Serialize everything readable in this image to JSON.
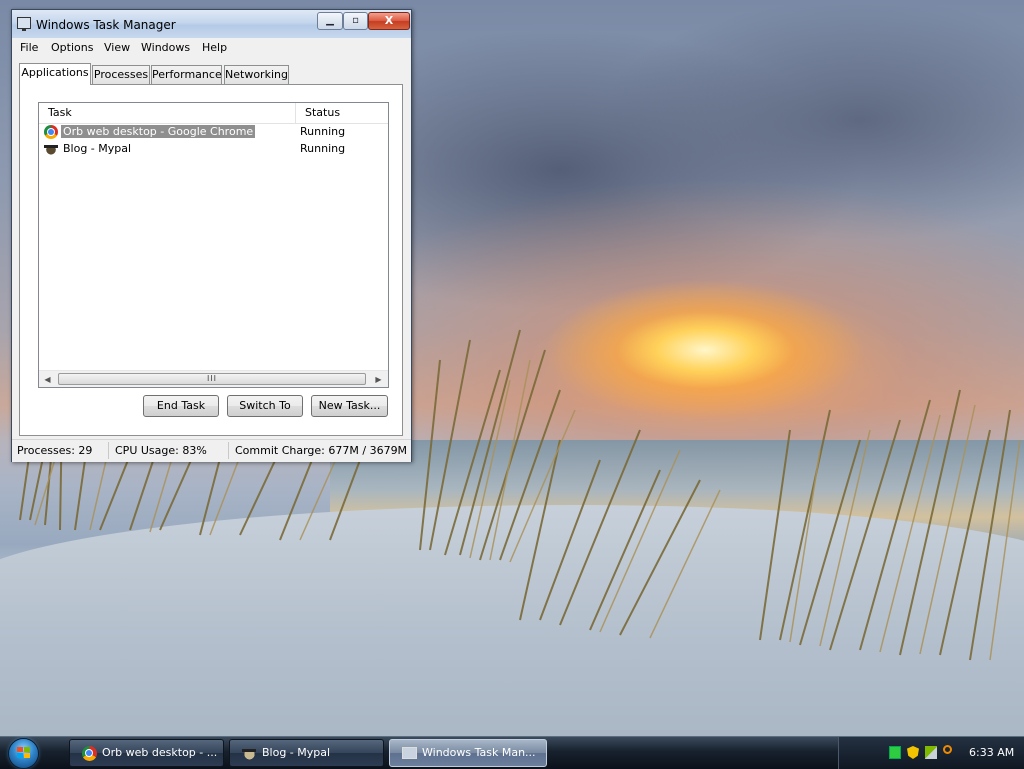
{
  "window": {
    "title": "Windows Task Manager",
    "caption_buttons": {
      "minimize": "▁",
      "maximize": "▫",
      "close": "X"
    }
  },
  "menu": [
    "File",
    "Options",
    "View",
    "Windows",
    "Help"
  ],
  "tabs": [
    "Applications",
    "Processes",
    "Performance",
    "Networking"
  ],
  "active_tab": "Applications",
  "list": {
    "columns": {
      "task": "Task",
      "status": "Status"
    },
    "rows": [
      {
        "task": "Orb web desktop - Google Chrome",
        "status": "Running",
        "icon": "chrome-icon",
        "selected": true
      },
      {
        "task": "Blog - Mypal",
        "status": "Running",
        "icon": "mypal-icon",
        "selected": false
      }
    ],
    "scroll": {
      "left": "◀",
      "right": "▶",
      "thumb": "III"
    }
  },
  "buttons": {
    "end_task": "End Task",
    "switch_to": "Switch To",
    "new_task": "New Task..."
  },
  "statusbar": {
    "processes": "Processes: 29",
    "cpu": "CPU Usage: 83%",
    "commit": "Commit Charge: 677M / 3679M"
  },
  "taskbar": {
    "items": [
      {
        "label": "Orb web desktop - ...",
        "icon": "chrome-icon"
      },
      {
        "label": "Blog - Mypal",
        "icon": "mypal-icon"
      },
      {
        "label": "Windows Task Man...",
        "icon": "task-manager-icon",
        "active": true
      }
    ],
    "clock": "6:33 AM"
  },
  "colors": {
    "selection": "#8f8f8f",
    "taskbar": "#17212d",
    "close_button": "#de5c43"
  }
}
